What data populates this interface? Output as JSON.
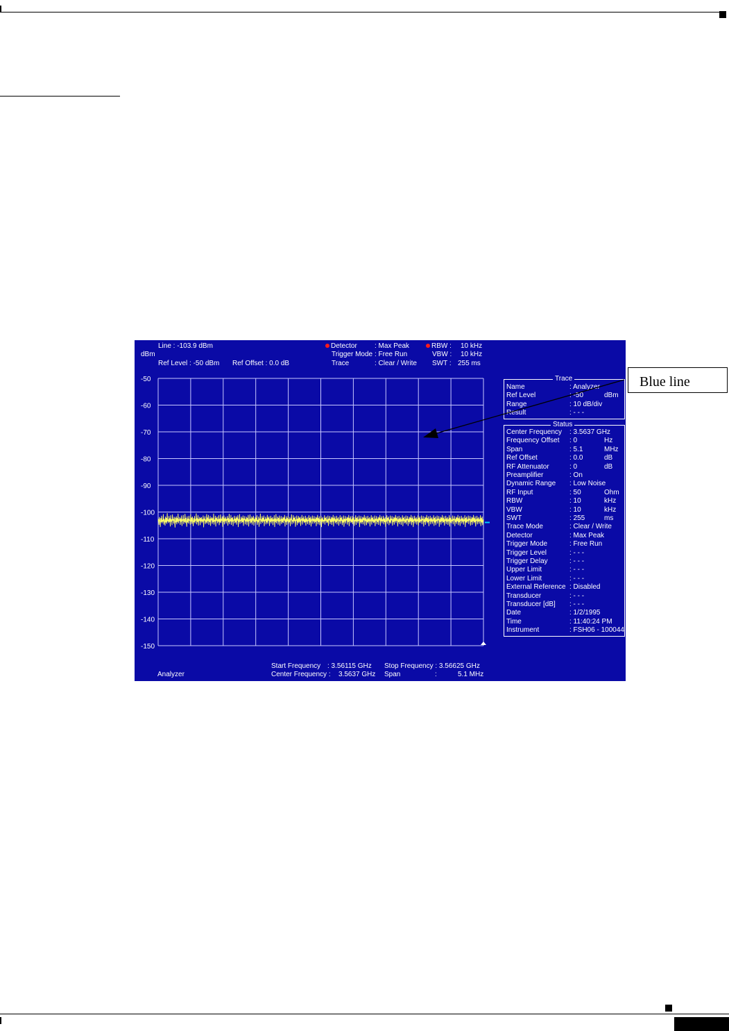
{
  "header": {
    "line": "Line : -103.9 dBm",
    "unit": "dBm",
    "ref_level": "Ref Level : -50 dBm",
    "ref_offset": "Ref Offset : 0.0 dB",
    "detector_label": "Detector",
    "detector_value": ": Max Peak",
    "trigger_mode_label": "Trigger Mode",
    "trigger_mode_value": ": Free Run",
    "trace_label": "Trace",
    "trace_value": ": Clear / Write",
    "rbw_label": "RBW :",
    "rbw_value": "10 kHz",
    "vbw_label": "VBW :",
    "vbw_value": "10 kHz",
    "swt_label": "SWT :",
    "swt_value": "255 ms"
  },
  "footer": {
    "mode": "Analyzer",
    "start_label": "Start Frequency",
    "start_value": ": 3.56115 GHz",
    "center_label": "Center Frequency :",
    "center_value": "3.5637 GHz",
    "stop_label": "Stop Frequency : 3.56625 GHz",
    "span_label": "Span",
    "span_value": ":",
    "span_amount": "5.1 MHz"
  },
  "trace_panel": {
    "title": "Trace",
    "rows": [
      {
        "label": "Name",
        "value": ": Analyzer",
        "unit": ""
      },
      {
        "label": "Ref Level",
        "value": ": -50",
        "unit": "dBm"
      },
      {
        "label": "Range",
        "value": ": 10 dB/div",
        "unit": ""
      },
      {
        "label": "Result",
        "value": ": - - -",
        "unit": ""
      }
    ]
  },
  "status_panel": {
    "title": "Status",
    "rows": [
      {
        "label": "Center Frequency",
        "value": ": 3.5637 GHz",
        "unit": ""
      },
      {
        "label": "Frequency Offset",
        "value": ": 0",
        "unit": "Hz"
      },
      {
        "label": "Span",
        "value": ": 5.1",
        "unit": "MHz"
      },
      {
        "label": "Ref Offset",
        "value": ": 0.0",
        "unit": "dB"
      },
      {
        "label": "RF Attenuator",
        "value": ": 0",
        "unit": "dB"
      },
      {
        "label": "Preamplifier",
        "value": ": On",
        "unit": ""
      },
      {
        "label": "Dynamic Range",
        "value": ": Low Noise",
        "unit": ""
      },
      {
        "label": "RF Input",
        "value": ": 50",
        "unit": "Ohm"
      },
      {
        "label": "RBW",
        "value": ": 10",
        "unit": "kHz"
      },
      {
        "label": "VBW",
        "value": ": 10",
        "unit": "kHz"
      },
      {
        "label": "SWT",
        "value": ": 255",
        "unit": "ms"
      },
      {
        "label": "Trace Mode",
        "value": ": Clear / Write",
        "unit": ""
      },
      {
        "label": "Detector",
        "value": ": Max Peak",
        "unit": ""
      },
      {
        "label": "Trigger Mode",
        "value": ": Free Run",
        "unit": ""
      },
      {
        "label": "Trigger Level",
        "value": ": - - -",
        "unit": ""
      },
      {
        "label": "Trigger Delay",
        "value": ": - - -",
        "unit": ""
      },
      {
        "label": "Upper Limit",
        "value": ": - - -",
        "unit": ""
      },
      {
        "label": "Lower Limit",
        "value": ": - - -",
        "unit": ""
      },
      {
        "label": "External Reference",
        "value": ": Disabled",
        "unit": ""
      },
      {
        "label": "Transducer",
        "value": ": - - -",
        "unit": ""
      },
      {
        "label": "Transducer [dB]",
        "value": ": - - -",
        "unit": ""
      },
      {
        "label": "Date",
        "value": ": 1/2/1995",
        "unit": ""
      },
      {
        "label": "Time",
        "value": ": 11:40:24 PM",
        "unit": ""
      },
      {
        "label": "Instrument",
        "value": ": FSH06 - 100044",
        "unit": ""
      }
    ]
  },
  "callout": {
    "text": "Blue line"
  },
  "colors": {
    "screen": "#0a0aa6",
    "trace": "#ffff66",
    "grid": "#c8c8ff",
    "marker": "#ff1a1a",
    "line_marker": "#00ccff"
  },
  "chart_data": {
    "type": "line",
    "ylabel": "dBm",
    "ylim": [
      -150,
      -50
    ],
    "yticks": [
      -50,
      -60,
      -70,
      -80,
      -90,
      -100,
      -110,
      -120,
      -130,
      -140,
      -150
    ],
    "grid": true,
    "x_range_ghz": [
      3.56115,
      3.56625
    ],
    "display_line_dbm": -103.9,
    "series": [
      {
        "values": [
          -103.5,
          -102.6,
          -104.8,
          -101.9,
          -103.1,
          -105.6,
          -102.3,
          -103.8,
          -101.4,
          -104.2,
          -102.9,
          -103.6,
          -100.8,
          -104.7,
          -102.5,
          -103.3,
          -105.1,
          -101.7,
          -103.9,
          -102.2,
          -104.4,
          -100.4,
          -103.5,
          -102.8,
          -104.1,
          -101.5,
          -103.7,
          -102.4,
          -105.4,
          -101.2,
          -103.6,
          -102.7,
          -104.9,
          -100.9,
          -103.2,
          -102.6,
          -104.3,
          -101.8,
          -103.4,
          -105.8,
          -102.1,
          -103.9,
          -101.6,
          -104.6,
          -102.3,
          -103.7,
          -100.6,
          -104.2,
          -102.9,
          -103.1,
          -101.9,
          -104.8,
          -102.4,
          -103.6,
          -101.3,
          -105.2,
          -102.7,
          -103.3,
          -101.1,
          -104.5,
          -102.6,
          -103.8,
          -100.7,
          -104.1,
          -102.2,
          -103.5,
          -105.5,
          -101.6,
          -103.9,
          -102.5,
          -104.3,
          -101.4,
          -103.2,
          -102.8,
          -104.7,
          -100.9,
          -103.6,
          -102.1,
          -104.4,
          -101.7,
          -103.4,
          -105.3,
          -102.3,
          -103.8,
          -101.5,
          -104.2,
          -102.9,
          -103.1,
          -100.5,
          -104.6,
          -102.4,
          -103.7,
          -101.2,
          -105.1,
          -102.6,
          -103.3,
          -101.8,
          -104.9,
          -102.2,
          -103.5,
          -101.9,
          -104.1,
          -102.7,
          -103.6,
          -101.3,
          -105.7,
          -102.5,
          -103.2,
          -101.6,
          -104.5,
          -102.8,
          -103.9,
          -100.8,
          -104.3,
          -102.1,
          -103.4,
          -101.1,
          -104.8,
          -102.6,
          -103.7,
          -101.5,
          -105.2,
          -102.4,
          -103.1,
          -101.9,
          -104.4,
          -102.3,
          -103.8,
          -100.6,
          -104.7,
          -102.9,
          -103.5,
          -101.4,
          -105.4,
          -102.2,
          -103.3,
          -101.7,
          -104.2,
          -102.7,
          -103.6,
          -101.2,
          -104.9,
          -102.5,
          -103.9,
          -100.9,
          -104.1,
          -102.8,
          -103.2,
          -101.6,
          -105.5,
          -102.1,
          -103.7,
          -101.3,
          -104.6,
          -102.4,
          -103.4,
          -101.8,
          -104.3,
          -102.6,
          -103.1,
          -101.5,
          -105.1,
          -102.3,
          -103.8,
          -100.7,
          -104.5,
          -102.7,
          -103.5,
          -101.1,
          -104.8,
          -102.2,
          -103.6,
          -101.9,
          -105.3,
          -102.8,
          -103.3,
          -101.4,
          -104.2,
          -102.5,
          -103.9,
          -101.6,
          -104.7,
          -102.1,
          -103.2,
          -101.2,
          -105.6,
          -102.6,
          -103.7,
          -100.8,
          -104.4,
          -102.9,
          -103.4,
          -101.7,
          -104.1,
          -102.3,
          -103.8,
          -101.3,
          -105.2,
          -102.4,
          -103.1,
          -101.5,
          -104.6,
          -102.7,
          -103.5,
          -101.8,
          -104.9,
          -102.2,
          -103.6,
          -101.1,
          -105.4,
          -102.8,
          -103.3,
          -100.9,
          -104.3,
          -102.5,
          -103.9,
          -101.6,
          -104.7,
          -102.1,
          -103.2,
          -101.4,
          -105.1,
          -102.6,
          -103.7,
          -101.9,
          -104.2,
          -102.3,
          -103.4,
          -101.2,
          -104.8,
          -102.9,
          -103.8,
          -101.7,
          -105.5,
          -102.4,
          -103.1,
          -100.6,
          -104.5,
          -102.7,
          -103.6,
          -101.5,
          -104.1,
          -102.2,
          -103.5,
          -101.3,
          -105.3,
          -102.8,
          -103.3,
          -101.8,
          -104.6,
          -102.5,
          -103.9,
          -101.1,
          -104.4,
          -102.1,
          -103.2,
          -101.6,
          -105.2,
          -102.6,
          -103.7,
          -101.4,
          -104.3,
          -102.3,
          -103.5,
          -101.9,
          -104.9,
          -102.7,
          -103.4,
          -101.2,
          -105.6,
          -102.4,
          -103.8,
          -100.8,
          -104.2,
          -102.9,
          -103.1,
          -101.7,
          -104.7,
          -102.2,
          -103.6,
          -101.3,
          -105.1,
          -102.8,
          -103.3,
          -101.5,
          -104.5,
          -102.5,
          -103.9,
          -101.8,
          -104.1,
          -102.1,
          -103.2,
          -101.1,
          -105.4,
          -102.6,
          -103.7,
          -101.6,
          -104.8,
          -102.3,
          -103.5,
          -101.4,
          -104.4,
          -102.7,
          -103.8,
          -101.9,
          -105.3,
          -102.4,
          -103.1,
          -100.9,
          -104.6,
          -102.9,
          -103.6,
          -101.2,
          -104.2,
          -102.2,
          -103.4,
          -101.7,
          -105.5,
          -102.8,
          -103.3,
          -101.3,
          -104.9,
          -102.5,
          -103.9,
          -101.5,
          -104.3,
          -102.1,
          -103.7,
          -101.8,
          -105.2,
          -102.6,
          -103.2,
          -101.1,
          -104.7,
          -102.3,
          -103.5,
          -101.6,
          -104.1,
          -102.7,
          -103.8,
          -101.4,
          -105.1,
          -102.4,
          -103.6,
          -101.9,
          -104.5,
          -102.9,
          -103.3,
          -101.2,
          -104.8,
          -102.2,
          -103.9,
          -101.7,
          -105.4,
          -102.8,
          -103.1,
          -101.3,
          -104.4,
          -102.5,
          -103.5,
          -101.5,
          -104.2,
          -102.6,
          -103.7,
          -101.8,
          -105.3,
          -102.1,
          -103.4,
          -101.1,
          -104.6,
          -102.3,
          -103.8,
          -101.6,
          -104.9,
          -102.7,
          -103.2,
          -101.4,
          -105.6,
          -102.4,
          -103.6,
          -101.9,
          -104.3,
          -102.9,
          -103.5,
          -101.2,
          -104.7,
          -102.2,
          -103.3,
          -101.7,
          -104.1,
          -102.8,
          -103.9,
          -101.3,
          -105.2,
          -102.5,
          -103.1,
          -101.5,
          -104.5,
          -102.6,
          -103.7,
          -101.8,
          -104.8,
          -102.1,
          -103.6,
          -101.1,
          -105.4,
          -102.3,
          -103.4,
          -101.6,
          -104.2,
          -102.7,
          -103.8,
          -101.4,
          -104.6,
          -102.4,
          -103.2,
          -101.9,
          -105.1,
          -102.9,
          -103.5,
          -101.2,
          -104.4,
          -102.2,
          -103.3,
          -101.7,
          -104.9,
          -102.8,
          -103.9,
          -101.3,
          -105.5,
          -102.5,
          -103.6,
          -101.5,
          -104.3,
          -102.6,
          -103.1,
          -101.8,
          -104.7,
          -102.1,
          -103.7,
          -101.1,
          -105.3,
          -102.3,
          -103.4,
          -101.6,
          -104.1,
          -102.7,
          -103.8,
          -101.4,
          -104.5,
          -102.4,
          -103.2,
          -101.9,
          -105.2,
          -102.9,
          -103.5,
          -101.2,
          -104.8,
          -102.2,
          -103.6,
          -101.7,
          -104.2,
          -102.8,
          -103.3,
          -101.3,
          -105.6,
          -102.5,
          -103.9,
          -101.5,
          -104.4,
          -102.6,
          -103.7,
          -101.8,
          -104.6,
          -102.1,
          -103.1,
          -101.1,
          -105.1,
          -102.3,
          -103.4,
          -101.6,
          -104.9,
          -102.7,
          -103.8,
          -101.4,
          -104.3,
          -102.4,
          -103.5,
          -101.9,
          -105.4,
          -102.9,
          -103.2,
          -101.2,
          -104.7,
          -102.2,
          -103.6,
          -101.7,
          -104.1,
          -102.8,
          -103.9,
          -101.3,
          -105.3,
          -102.5,
          -103.3,
          -101.5,
          -104.5,
          -102.6,
          -103.7,
          -101.8,
          -104.8,
          -102.1,
          -103.1,
          -101.1,
          -105.2,
          -102.3,
          -103.5,
          -101.6,
          -104.2,
          -102.7,
          -103.4,
          -101.4,
          -104.6,
          -102.4,
          -103.8,
          -101.9,
          -105.5,
          -102.9,
          -103.6,
          -101.2,
          -104.4,
          -102.2,
          -103.2,
          -101.7,
          -104.9,
          -102.8,
          -103.9,
          -101.3,
          -104.3,
          -102.5,
          -103.1,
          -101.5,
          -105.1,
          -102.6,
          -103.7,
          -101.8,
          -104.7,
          -102.1,
          -103.5,
          -101.1,
          -104.1,
          -102.3,
          -103.3,
          -101.6,
          -105.4,
          -102.7,
          -103.8,
          -101.4,
          -104.5,
          -102.4,
          -103.6,
          -101.9,
          -104.8,
          -102.9,
          -103.2,
          -101.2,
          -105.3,
          -102.2,
          -103.4,
          -101.7,
          -104.2,
          -102.8,
          -103.9,
          -101.3,
          -104.6,
          -102.5,
          -103.1,
          -101.5,
          -105.2,
          -102.6,
          -103.7,
          -101.8,
          -104.4,
          -102.1,
          -103.5,
          -101.1,
          -104.9,
          -102.3,
          -103.8,
          -101.6,
          -105.6,
          -102.7,
          -103.3,
          -101.4,
          -104.3,
          -102.4,
          -103.6,
          -101.9,
          -104.7,
          -102.9,
          -103.2,
          -101.2,
          -105.1,
          -102.2,
          -103.9,
          -101.7,
          -104.1,
          -102.8,
          -103.4,
          -101.3,
          -104.5,
          -102.5,
          -103.1,
          -101.5,
          -105.4,
          -102.6,
          -103.7,
          -101.8,
          -104.8,
          -102.1,
          -103.5,
          -101.1,
          -104.2,
          -102.3,
          -103.8,
          -101.6,
          -105.3,
          -102.7,
          -103.3,
          -101.4,
          -104.6,
          -102.4,
          -103.6,
          -101.9,
          -104.4,
          -102.9,
          -103.2,
          -101.2,
          -105.2,
          -102.2,
          -103.9,
          -101.7,
          -104.9,
          -102.8,
          -103.4,
          -101.3,
          -104.3,
          -102.5,
          -103.1,
          -101.5,
          -105.5,
          -102.6,
          -103.7,
          -101.8,
          -104.7,
          -102.1,
          -103.5,
          -101.1,
          -104.1,
          -102.3,
          -103.8,
          -101.6,
          -105.1,
          -102.7,
          -103.3,
          -101.4,
          -104.5,
          -102.4,
          -103.6,
          -101.9,
          -104.8,
          -102.9,
          -103.2,
          -101.2,
          -105.4,
          -102.2,
          -103.9,
          -101.7,
          -104.2,
          -102.8,
          -103.4,
          -101.3,
          -104.6,
          -102.5,
          -103.1,
          -101.5,
          -105.3,
          -102.6,
          -103.7,
          -101.8,
          -104.4,
          -102.1,
          -103.5,
          -101.1,
          -104.9,
          -102.3,
          -103.8,
          -101.6,
          -105.2,
          -102.7,
          -103.3,
          -101.4,
          -104.3,
          -102.4,
          -103.6,
          -101.9,
          -104.7,
          -102.9,
          -103.2,
          -101.2,
          -105.6,
          -102.2,
          -103.9,
          -101.7,
          -104.1,
          -102.8,
          -103.4,
          -101.3,
          -104.5,
          -102.5,
          -103.1,
          -101.5,
          -105.1,
          -102.6,
          -103.7,
          -101.8,
          -104.8,
          -102.1,
          -103.5,
          -101.1,
          -104.2,
          -102.3,
          -103.8,
          -101.6,
          -105.4,
          -102.7,
          -103.3,
          -101.4,
          -104.6,
          -102.4,
          -103.6,
          -101.9,
          -104.4,
          -102.9,
          -103.2,
          -101.2,
          -105.3,
          -102.2,
          -103.9,
          -101.7,
          -104.9,
          -102.8,
          -103.4
        ]
      }
    ]
  }
}
